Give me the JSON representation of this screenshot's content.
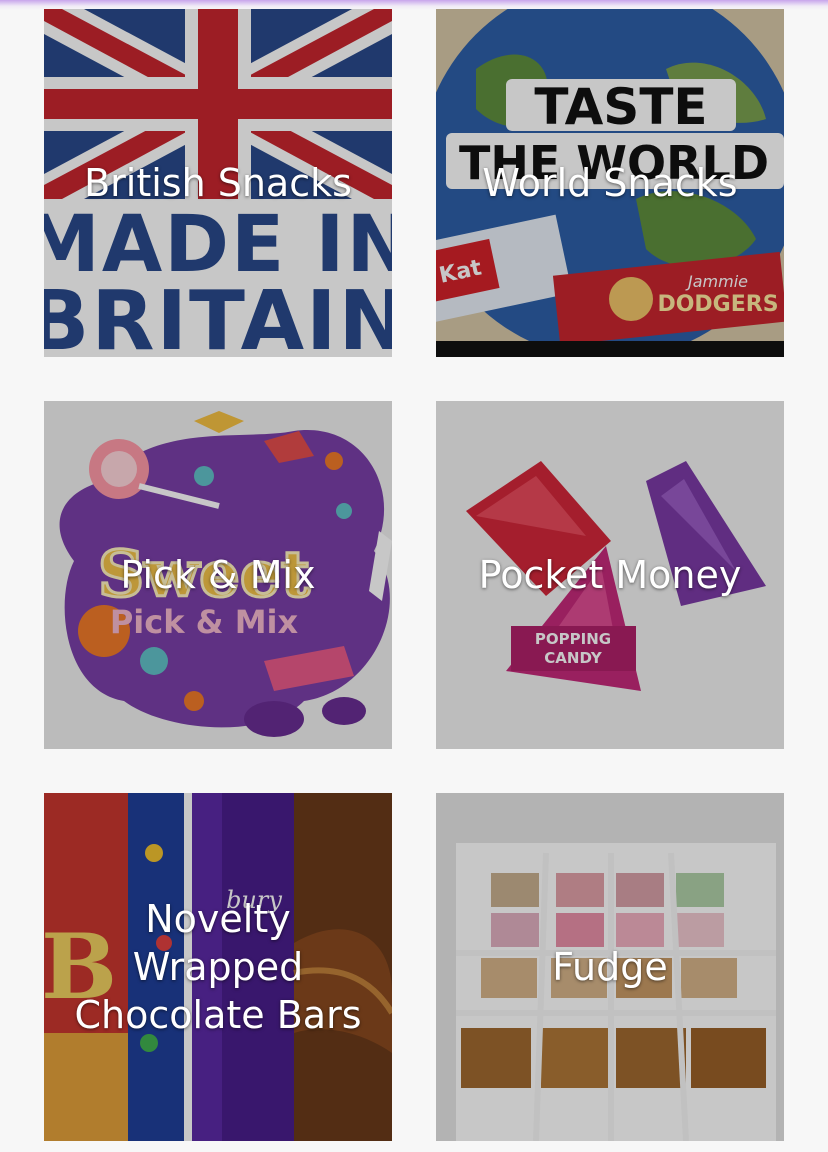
{
  "categories": [
    {
      "label": "British Snacks",
      "image": "uk-flag-made-in-britain",
      "art_text": [
        "MADE IN",
        "BRITAIN"
      ]
    },
    {
      "label": "World Snacks",
      "image": "taste-the-world-globe",
      "art_text": [
        "TASTE",
        "THE WORLD",
        "Jammie",
        "DODGERS",
        "Kat"
      ]
    },
    {
      "label": "Pick & Mix",
      "image": "sweet-pick-and-mix",
      "art_text": [
        "Sweet",
        "Pick & Mix"
      ]
    },
    {
      "label": "Pocket Money",
      "image": "popping-candy-packets",
      "art_text": [
        "POPPING",
        "CANDY"
      ]
    },
    {
      "label": "Novelty Wrapped Chocolate Bars",
      "image": "chocolate-bar-wrappers",
      "art_text": [
        "B",
        "bury"
      ]
    },
    {
      "label": "Fudge",
      "image": "fudge-box-compartments"
    }
  ],
  "colors": {
    "background": "#f7f7f7",
    "label": "#ffffff",
    "top_glow": "#c5a0eb"
  }
}
